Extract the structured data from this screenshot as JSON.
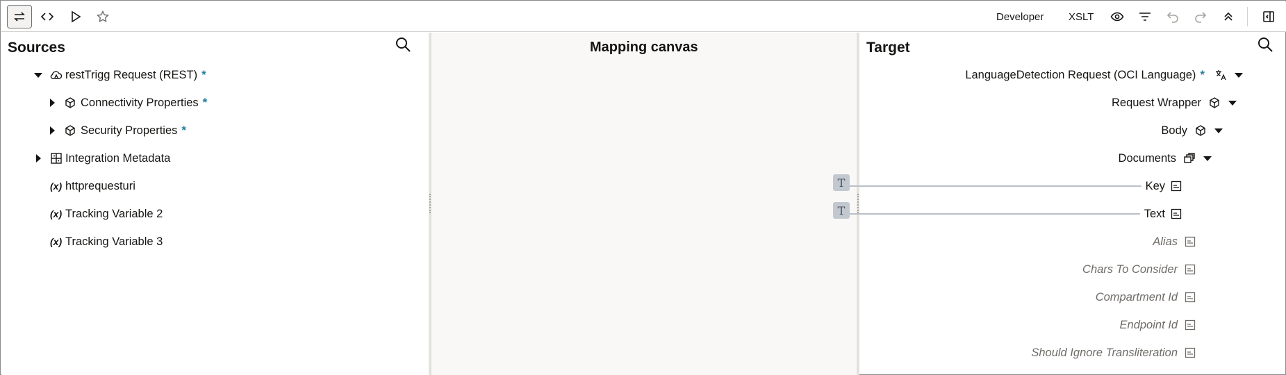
{
  "toolbar": {
    "developer_label": "Developer",
    "xslt_label": "XSLT"
  },
  "sources": {
    "title": "Sources",
    "items": [
      {
        "label": "restTrigg Request (REST)",
        "required": "*"
      },
      {
        "label": "Connectivity Properties",
        "required": "*"
      },
      {
        "label": "Security Properties",
        "required": "*"
      },
      {
        "label": "Integration Metadata"
      },
      {
        "label": "httprequesturi",
        "prefix": "(x)"
      },
      {
        "label": "Tracking Variable 2",
        "prefix": "(x)"
      },
      {
        "label": "Tracking Variable 3",
        "prefix": "(x)"
      }
    ]
  },
  "canvas": {
    "title": "Mapping canvas",
    "functions": [
      {
        "glyph": "T"
      },
      {
        "glyph": "T"
      }
    ]
  },
  "target": {
    "title": "Target",
    "items": [
      {
        "label": "LanguageDetection Request (OCI Language)",
        "required": "*"
      },
      {
        "label": "Request Wrapper"
      },
      {
        "label": "Body"
      },
      {
        "label": "Documents"
      },
      {
        "label": "Key"
      },
      {
        "label": "Text"
      },
      {
        "label": "Alias"
      },
      {
        "label": "Chars To Consider"
      },
      {
        "label": "Compartment Id"
      },
      {
        "label": "Endpoint Id"
      },
      {
        "label": "Should Ignore Transliteration"
      }
    ]
  },
  "colors": {
    "required_marker": "#227e9e",
    "map_line": "#b7c0c8",
    "canvas_bg": "#f9f8f7"
  }
}
